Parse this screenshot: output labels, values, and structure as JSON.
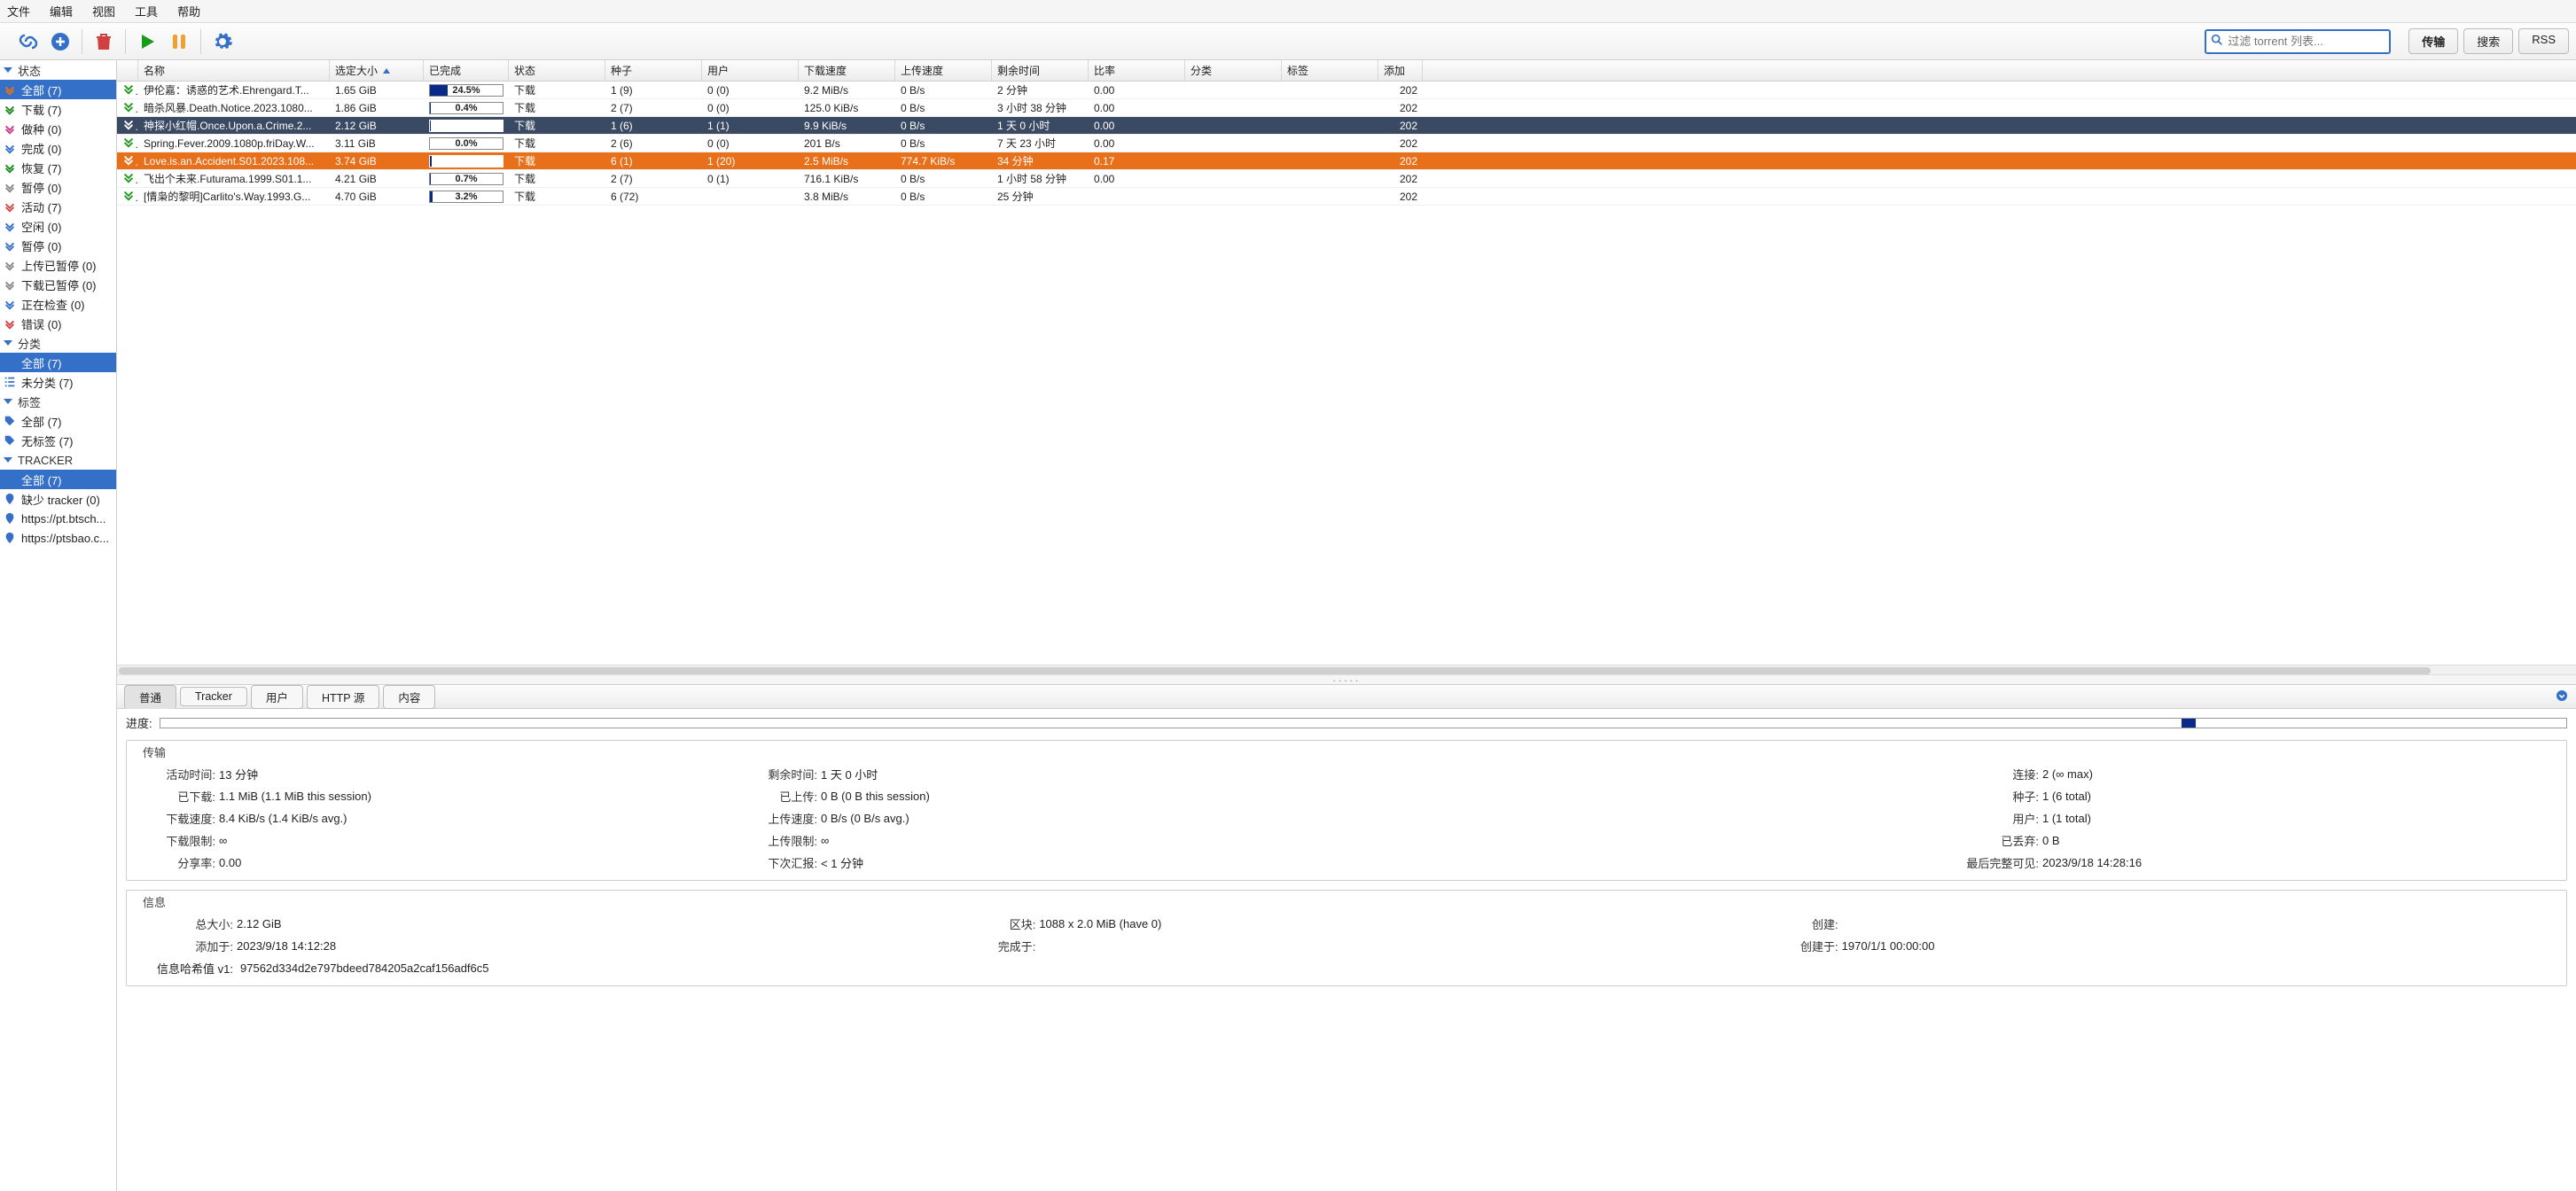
{
  "menu": {
    "file": "文件",
    "edit": "编辑",
    "view": "视图",
    "tools": "工具",
    "help": "帮助"
  },
  "toolbar": {
    "search_placeholder": "过滤 torrent 列表...",
    "tab_transfers": "传输",
    "tab_search": "搜索",
    "tab_rss": "RSS"
  },
  "sidebar": {
    "status_head": "状态",
    "status": [
      {
        "id": "all",
        "label": "全部 (7)",
        "sel": true,
        "color": "#e8701b"
      },
      {
        "id": "downloading",
        "label": "下载 (7)",
        "color": "#1a8a1a"
      },
      {
        "id": "seeding",
        "label": "做种 (0)",
        "color": "#c83a8a"
      },
      {
        "id": "completed",
        "label": "完成 (0)",
        "color": "#3470c8"
      },
      {
        "id": "resumed",
        "label": "恢复 (7)",
        "color": "#1a8a1a"
      },
      {
        "id": "paused",
        "label": "暂停 (0)",
        "color": "#888"
      },
      {
        "id": "active",
        "label": "活动 (7)",
        "color": "#d04848"
      },
      {
        "id": "inactive",
        "label": "空闲 (0)",
        "color": "#3470c8"
      },
      {
        "id": "stalled",
        "label": "暂停 (0)",
        "color": "#3470c8"
      },
      {
        "id": "stalled_up",
        "label": "上传已暂停 (0)",
        "color": "#888"
      },
      {
        "id": "stalled_dl",
        "label": "下载已暂停 (0)",
        "color": "#888"
      },
      {
        "id": "checking",
        "label": "正在检查 (0)",
        "color": "#3470c8"
      },
      {
        "id": "errored",
        "label": "错误 (0)",
        "color": "#d04040"
      }
    ],
    "categories_head": "分类",
    "categories": [
      {
        "id": "cat_all",
        "label": "全部 (7)",
        "sel": true
      },
      {
        "id": "cat_uncat",
        "label": "未分类 (7)"
      }
    ],
    "tags_head": "标签",
    "tags": [
      {
        "id": "tag_all",
        "label": "全部 (7)"
      },
      {
        "id": "tag_untag",
        "label": "无标签 (7)"
      }
    ],
    "trackers_head": "TRACKER",
    "trackers": [
      {
        "id": "tr_all",
        "label": "全部 (7)",
        "sel": true
      },
      {
        "id": "tr_missing",
        "label": "缺少 tracker (0)"
      },
      {
        "id": "tr_1",
        "label": "https://pt.btsch..."
      },
      {
        "id": "tr_2",
        "label": "https://ptsbao.c..."
      }
    ]
  },
  "columns": {
    "name": "名称",
    "size": "选定大小",
    "progress": "已完成",
    "status": "状态",
    "seeds": "种子",
    "peers": "用户",
    "dlspeed": "下载速度",
    "ulspeed": "上传速度",
    "eta": "剩余时间",
    "ratio": "比率",
    "category": "分类",
    "tags": "标签",
    "added": "添加"
  },
  "torrents": [
    {
      "name": "伊伦嘉：诱惑的艺术.Ehrengard.T...",
      "size": "1.65 GiB",
      "progress": "24.5%",
      "pw": 24.5,
      "status": "下载",
      "seeds": "1 (9)",
      "peers": "0 (0)",
      "dl": "9.2 MiB/s",
      "ul": "0 B/s",
      "eta": "2 分钟",
      "ratio": "0.00",
      "added": "202"
    },
    {
      "name": "暗杀风暴.Death.Notice.2023.1080...",
      "size": "1.86 GiB",
      "progress": "0.4%",
      "pw": 0.4,
      "status": "下载",
      "seeds": "2 (7)",
      "peers": "0 (0)",
      "dl": "125.0 KiB/s",
      "ul": "0 B/s",
      "eta": "3 小时 38 分钟",
      "ratio": "0.00",
      "added": "202"
    },
    {
      "name": "神探小红帽.Once.Upon.a.Crime.2...",
      "size": "2.12 GiB",
      "progress": "0.1%",
      "pw": 0.1,
      "status": "下载",
      "seeds": "1 (6)",
      "peers": "1 (1)",
      "dl": "9.9 KiB/s",
      "ul": "0 B/s",
      "eta": "1 天 0 小时",
      "ratio": "0.00",
      "added": "202",
      "sel": "sel1"
    },
    {
      "name": "Spring.Fever.2009.1080p.friDay.W...",
      "size": "3.11 GiB",
      "progress": "0.0%",
      "pw": 0,
      "status": "下载",
      "seeds": "2 (6)",
      "peers": "0 (0)",
      "dl": "201 B/s",
      "ul": "0 B/s",
      "eta": "7 天 23 小时",
      "ratio": "0.00",
      "added": "202"
    },
    {
      "name": "Love.is.an.Accident.S01.2023.108...",
      "size": "3.74 GiB",
      "progress": "2.5%",
      "pw": 2.5,
      "status": "下载",
      "seeds": "6 (1)",
      "peers": "1 (20)",
      "dl": "2.5 MiB/s",
      "ul": "774.7 KiB/s",
      "eta": "34 分钟",
      "ratio": "0.17",
      "added": "202",
      "sel": "sel2"
    },
    {
      "name": "飞出个未来.Futurama.1999.S01.1...",
      "size": "4.21 GiB",
      "progress": "0.7%",
      "pw": 0.7,
      "status": "下载",
      "seeds": "2 (7)",
      "peers": "0 (1)",
      "dl": "716.1 KiB/s",
      "ul": "0 B/s",
      "eta": "1 小时 58 分钟",
      "ratio": "0.00",
      "added": "202"
    },
    {
      "name": "[情枭的黎明]Carlito's.Way.1993.G...",
      "size": "4.70 GiB",
      "progress": "3.2%",
      "pw": 3.2,
      "status": "下载",
      "seeds": "6 (72)",
      "peers": "",
      "dl": "3.8 MiB/s",
      "ul": "0 B/s",
      "eta": "25 分钟",
      "ratio": "",
      "added": "202"
    }
  ],
  "detail_tabs": {
    "general": "普通",
    "trackers": "Tracker",
    "peers": "用户",
    "http": "HTTP 源",
    "content": "内容"
  },
  "detail": {
    "progress_label": "进度:",
    "transfer_head": "传输",
    "active_time_k": "活动时间:",
    "active_time_v": "13 分钟",
    "eta_k": "剩余时间:",
    "eta_v": "1 天 0 小时",
    "connections_k": "连接:",
    "connections_v": "2 (∞ max)",
    "downloaded_k": "已下载:",
    "downloaded_v": "1.1 MiB (1.1 MiB this session)",
    "uploaded_k": "已上传:",
    "uploaded_v": "0 B (0 B this session)",
    "seeds_k": "种子:",
    "seeds_v": "1 (6 total)",
    "dlspeed_k": "下载速度:",
    "dlspeed_v": "8.4 KiB/s (1.4 KiB/s avg.)",
    "ulspeed_k": "上传速度:",
    "ulspeed_v": "0 B/s (0 B/s avg.)",
    "peers_k": "用户:",
    "peers_v": "1 (1 total)",
    "dllimit_k": "下载限制:",
    "dllimit_v": "∞",
    "ullimit_k": "上传限制:",
    "ullimit_v": "∞",
    "wasted_k": "已丢弃:",
    "wasted_v": "0 B",
    "ratio_k": "分享率:",
    "ratio_v": "0.00",
    "reannounce_k": "下次汇报:",
    "reannounce_v": "< 1 分钟",
    "lastseen_k": "最后完整可见:",
    "lastseen_v": "2023/9/18 14:28:16",
    "info_head": "信息",
    "totalsize_k": "总大小:",
    "totalsize_v": "2.12 GiB",
    "pieces_k": "区块:",
    "pieces_v": "1088 x 2.0 MiB (have 0)",
    "createdby_k": "创建:",
    "createdby_v": "",
    "addedon_k": "添加于:",
    "addedon_v": "2023/9/18 14:12:28",
    "completedon_k": "完成于:",
    "completedon_v": "",
    "createdon_k": "创建于:",
    "createdon_v": "1970/1/1 00:00:00",
    "hash_k": "信息哈希值 v1:",
    "hash_v": "97562d334d2e797bdeed784205a2caf156adf6c5"
  }
}
